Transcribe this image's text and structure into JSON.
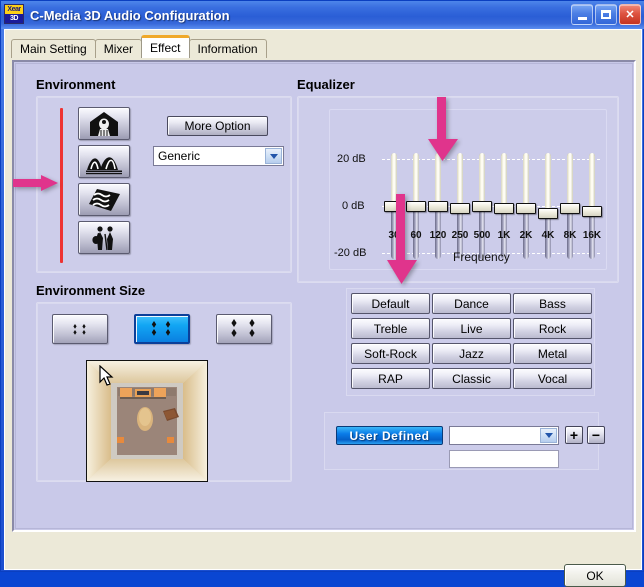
{
  "window": {
    "title": "C-Media 3D Audio Configuration",
    "icon": "xear-3d-icon",
    "icon_text_top": "Xear",
    "icon_text_bottom": "3D",
    "minimize_label": "minimize-icon",
    "maximize_label": "maximize-icon",
    "close_label": "✕"
  },
  "tabs": [
    {
      "label": "Main Setting",
      "active": false
    },
    {
      "label": "Mixer",
      "active": false
    },
    {
      "label": "Effect",
      "active": true
    },
    {
      "label": "Information",
      "active": false
    }
  ],
  "environment": {
    "title": "Environment",
    "buttons": [
      {
        "name": "environment-cave",
        "icon": "house-cave-icon"
      },
      {
        "name": "environment-mountains",
        "icon": "mountains-icon"
      },
      {
        "name": "environment-carpet",
        "icon": "carpet-wave-icon"
      },
      {
        "name": "environment-concert",
        "icon": "musicians-icon"
      }
    ],
    "more_option_label": "More Option",
    "preset_value": "Generic"
  },
  "environment_size": {
    "title": "Environment Size",
    "sizes": [
      {
        "name": "size-small",
        "selected": false
      },
      {
        "name": "size-medium",
        "selected": true
      },
      {
        "name": "size-large",
        "selected": false
      }
    ]
  },
  "equalizer": {
    "title": "Equalizer",
    "axis_labels": [
      "20 dB",
      "0  dB",
      "-20 dB"
    ],
    "frequency_label": "Frequency",
    "bands": [
      {
        "freq": "30",
        "value": 0
      },
      {
        "freq": "60",
        "value": 0
      },
      {
        "freq": "120",
        "value": 0
      },
      {
        "freq": "250",
        "value": -1
      },
      {
        "freq": "500",
        "value": 0
      },
      {
        "freq": "1K",
        "value": -1
      },
      {
        "freq": "2K",
        "value": -1
      },
      {
        "freq": "4K",
        "value": -3
      },
      {
        "freq": "8K",
        "value": -1
      },
      {
        "freq": "16K",
        "value": -2
      }
    ],
    "presets": [
      [
        "Default",
        "Dance",
        "Bass"
      ],
      [
        "Treble",
        "Live",
        "Rock"
      ],
      [
        "Soft-Rock",
        "Jazz",
        "Metal"
      ],
      [
        "RAP",
        "Classic",
        "Vocal"
      ]
    ],
    "user_defined": {
      "button_label": "User  Defined",
      "combo_value": "",
      "name_value": "",
      "add_label": "+",
      "remove_label": "−"
    }
  },
  "footer": {
    "ok_label": "OK"
  },
  "annotations": {
    "arrow_color": "#e0348c",
    "line_color": "#ee3333"
  },
  "colors": {
    "title_bar": "#2f62d8",
    "panel": "#c9c9e9",
    "client": "#ece9d8",
    "accent_tab": "#f0a92a",
    "selected_blue": "#0a7ce8"
  }
}
